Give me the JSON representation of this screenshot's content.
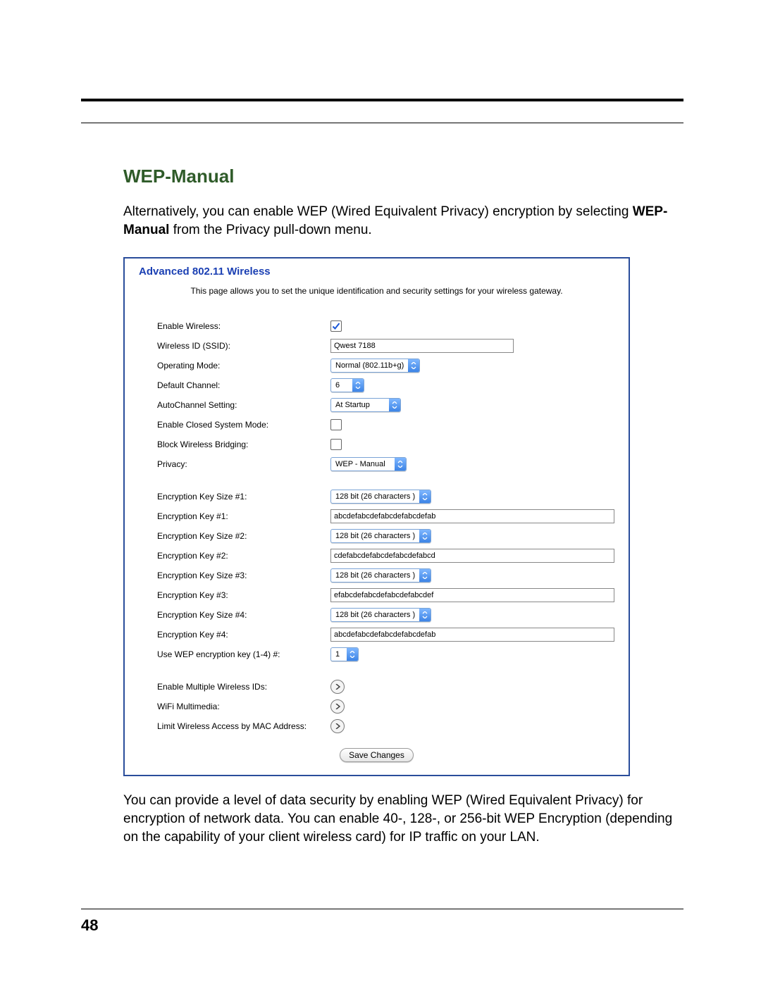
{
  "page_number": "48",
  "heading": "WEP-Manual",
  "intro": {
    "line1": "Alternatively, you can enable WEP (Wired Equivalent Privacy) encryption by selecting ",
    "strong": "WEP-Manual",
    "line2": " from the Privacy pull-down menu."
  },
  "panel": {
    "title": "Advanced 802.11 Wireless",
    "desc": "This page allows you to set the unique identification and security settings for your wireless gateway.",
    "fields": {
      "enable_wireless": {
        "label": "Enable Wireless:",
        "checked": true
      },
      "ssid": {
        "label": "Wireless ID (SSID):",
        "value": "Qwest 7188"
      },
      "op_mode": {
        "label": "Operating Mode:",
        "value": "Normal (802.11b+g)"
      },
      "channel": {
        "label": "Default Channel:",
        "value": "6"
      },
      "autochan": {
        "label": "AutoChannel Setting:",
        "value": "At Startup"
      },
      "closed": {
        "label": "Enable Closed System Mode:",
        "checked": false
      },
      "block_bridge": {
        "label": "Block Wireless Bridging:",
        "checked": false
      },
      "privacy": {
        "label": "Privacy:",
        "value": "WEP - Manual"
      },
      "ksize1": {
        "label": "Encryption Key Size #1:",
        "value": "128 bit (26 characters )"
      },
      "key1": {
        "label": "Encryption Key #1:",
        "value": "abcdefabcdefabcdefabcdefab"
      },
      "ksize2": {
        "label": "Encryption Key Size #2:",
        "value": "128 bit (26 characters )"
      },
      "key2": {
        "label": "Encryption Key #2:",
        "value": "cdefabcdefabcdefabcdefabcd"
      },
      "ksize3": {
        "label": "Encryption Key Size #3:",
        "value": "128 bit (26 characters )"
      },
      "key3": {
        "label": "Encryption Key #3:",
        "value": "efabcdefabcdefabcdefabcdef"
      },
      "ksize4": {
        "label": "Encryption Key Size #4:",
        "value": "128 bit (26 characters )"
      },
      "key4": {
        "label": "Encryption Key #4:",
        "value": "abcdefabcdefabcdefabcdefab"
      },
      "use_key": {
        "label": "Use WEP encryption key (1-4) #:",
        "value": "1"
      },
      "multi_ssid": {
        "label": "Enable Multiple Wireless IDs:"
      },
      "wmm": {
        "label": "WiFi Multimedia:"
      },
      "mac_limit": {
        "label": "Limit Wireless Access by MAC Address:"
      }
    },
    "save_label": "Save Changes"
  },
  "tail_paragraph": "You can provide a level of data security by enabling WEP (Wired Equivalent Privacy) for encryption of network data. You can enable 40-, 128-, or 256-bit WEP Encryption (depending on the capability of your client wireless card) for IP traffic on your LAN."
}
